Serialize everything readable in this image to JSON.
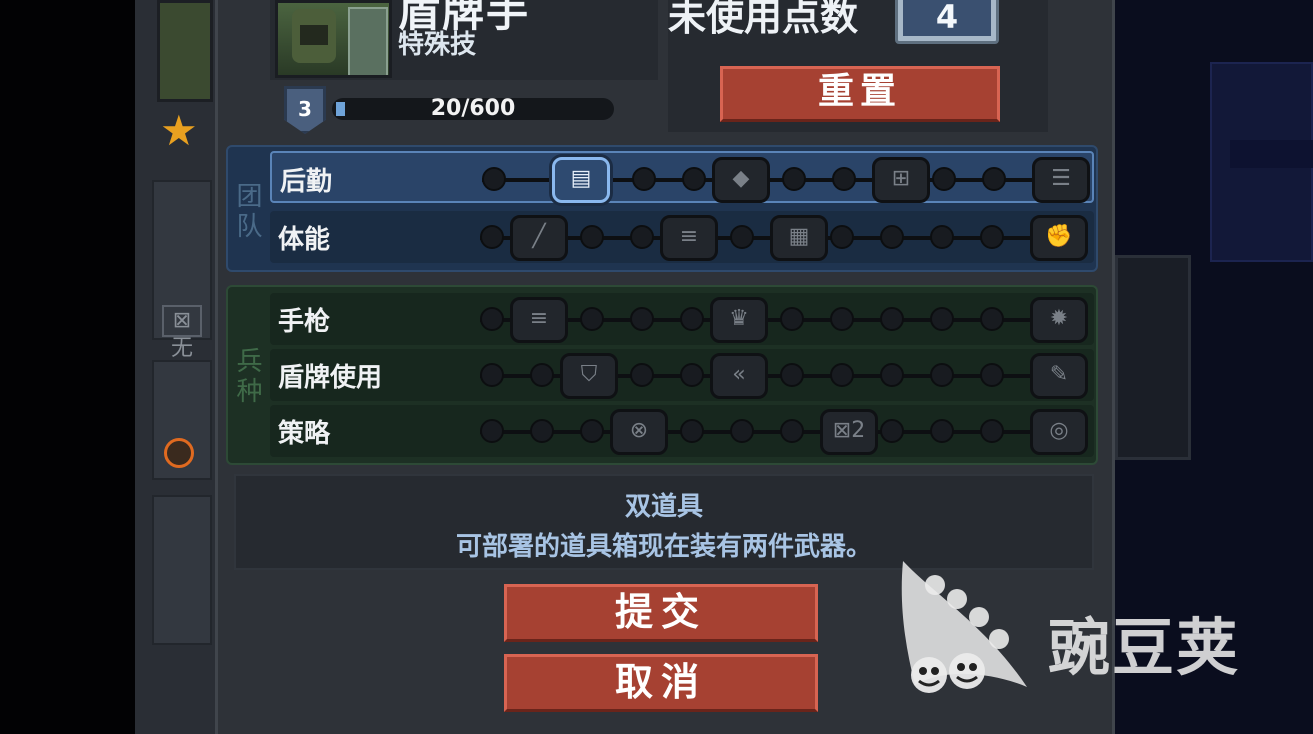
{
  "header": {
    "unit_name": "盾牌手",
    "unit_subtitle": "特殊技",
    "points_label": "未使用点数",
    "points_value": "4",
    "reset_label": "重置",
    "level": "3",
    "xp_text": "20/600",
    "xp_progress": 0.033
  },
  "sections": {
    "team_label": "团队",
    "class_label": "兵种"
  },
  "skill_rows": [
    {
      "label": "后勤",
      "icons": [
        "ammo-crate-icon",
        "armor-plus-icon",
        "medkit-icon",
        "supply-icon"
      ],
      "selected": "ammo-crate-icon"
    },
    {
      "label": "体能",
      "icons": [
        "knife-icon",
        "dash-icon",
        "grid-icon",
        "fist-icon"
      ]
    },
    {
      "label": "手枪",
      "icons": [
        "ammo-plus-icon",
        "crown-icon",
        "burst-icon"
      ]
    },
    {
      "label": "盾牌使用",
      "icons": [
        "shield-badge-icon",
        "shield-bash-icon",
        "wrench-icon"
      ]
    },
    {
      "label": "策略",
      "icons": [
        "gun-target-icon",
        "x2-icon",
        "target-shield-icon"
      ],
      "icon_texts": [
        "",
        "⊠2",
        ""
      ]
    }
  ],
  "description": {
    "title": "双道具",
    "text": "可部署的道具箱现在装有两件武器。"
  },
  "buttons": {
    "submit": "提交",
    "cancel": "取消"
  },
  "roster": {
    "star_glyph": "★",
    "unknown_label": "⊠无"
  },
  "watermark": {
    "text": "豌豆荚"
  }
}
